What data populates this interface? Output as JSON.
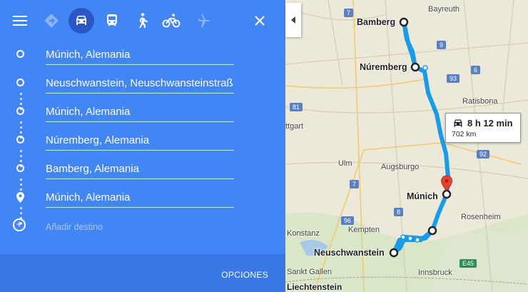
{
  "topbar": {
    "menu_icon": "menu-icon",
    "modes": [
      "best-route-icon",
      "car-icon",
      "transit-icon",
      "walk-icon",
      "bike-icon",
      "flight-icon"
    ],
    "selected_mode": "car",
    "close_icon": "close-icon"
  },
  "stops": [
    {
      "label": "Múnich, Alemania",
      "marker": "circle"
    },
    {
      "label": "Neuschwanstein, Neuschwansteinstraß",
      "marker": "circle"
    },
    {
      "label": "Múnich, Alemania",
      "marker": "circle"
    },
    {
      "label": "Núremberg, Alemania",
      "marker": "circle"
    },
    {
      "label": "Bamberg, Alemania",
      "marker": "circle"
    },
    {
      "label": "Múnich, Alemania",
      "marker": "pin"
    }
  ],
  "add_destination": "Añadir destino",
  "footer": {
    "options_label": "OPCIONES"
  },
  "map": {
    "route_color": "#1a9be8",
    "cities": [
      "Bamberg",
      "Núremberg",
      "Múnich",
      "Neuschwanstein"
    ],
    "places": [
      "Bayreuth",
      "Ratisbona",
      "ttgart",
      "Ulm",
      "Augsburgo",
      "Rosenheim",
      "Kempten",
      "Innsbruck",
      "Konstanz",
      "Sankt Gallen",
      "Liechtenstein"
    ],
    "road_shields": [
      "7",
      "9",
      "6",
      "81",
      "92",
      "7",
      "8",
      "96",
      "E45",
      "93"
    ],
    "callout": {
      "time": "8 h 12 min",
      "distance": "702 km"
    }
  }
}
